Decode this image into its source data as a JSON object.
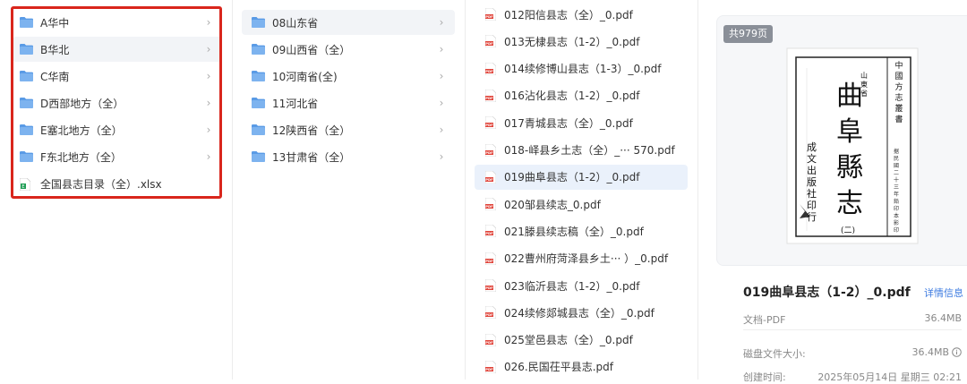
{
  "col1": {
    "items": [
      {
        "label": "A华中",
        "type": "folder",
        "chevron": true,
        "selected": false
      },
      {
        "label": "B华北",
        "type": "folder",
        "chevron": true,
        "selected": true
      },
      {
        "label": "C华南",
        "type": "folder",
        "chevron": true,
        "selected": false
      },
      {
        "label": "D西部地方（全）",
        "type": "folder",
        "chevron": true,
        "selected": false
      },
      {
        "label": "E塞北地方（全）",
        "type": "folder",
        "chevron": true,
        "selected": false
      },
      {
        "label": "F东北地方（全）",
        "type": "folder",
        "chevron": true,
        "selected": false
      },
      {
        "label": "全国县志目录（全）.xlsx",
        "type": "xlsx",
        "chevron": false,
        "selected": false
      }
    ]
  },
  "col2": {
    "items": [
      {
        "label": "08山东省",
        "selected": true
      },
      {
        "label": "09山西省（全）",
        "selected": false
      },
      {
        "label": "10河南省(全)",
        "selected": false
      },
      {
        "label": "11河北省",
        "selected": false
      },
      {
        "label": "12陕西省（全）",
        "selected": false
      },
      {
        "label": "13甘肃省（全）",
        "selected": false
      }
    ]
  },
  "col3": {
    "items": [
      {
        "label": "012阳信县志（全）_0.pdf",
        "active": false
      },
      {
        "label": "013无棣县志（1-2）_0.pdf",
        "active": false
      },
      {
        "label": "014续修博山县志（1-3）_0.pdf",
        "active": false
      },
      {
        "label": "016沾化县志（1-2）_0.pdf",
        "active": false
      },
      {
        "label": "017青城县志（全）_0.pdf",
        "active": false
      },
      {
        "label": "018-峄县乡土志（全）_··· 570.pdf",
        "active": false
      },
      {
        "label": "019曲阜县志（1-2）_0.pdf",
        "active": true
      },
      {
        "label": "020邹县续志_0.pdf",
        "active": false
      },
      {
        "label": "021滕县续志稿（全）_0.pdf",
        "active": false
      },
      {
        "label": "022曹州府菏泽县乡土···  ）_0.pdf",
        "active": false
      },
      {
        "label": "023临沂县志（1-2）_0.pdf",
        "active": false
      },
      {
        "label": "024续修郯城县志（全）_0.pdf",
        "active": false
      },
      {
        "label": "025堂邑县志（全）_0.pdf",
        "active": false
      },
      {
        "label": "026.民国茌平县志.pdf",
        "active": false
      }
    ],
    "pdf_badge": "PDF"
  },
  "preview": {
    "page_count": "共979页",
    "book": {
      "big_title": [
        "曲",
        "阜",
        "縣",
        "志"
      ],
      "vol": "(二)",
      "province": "山東省",
      "series": "中國方志叢書",
      "publisher": "成文出版社印行",
      "small_note": "据民國二十三年鉛印本影印"
    },
    "file_title": "019曲阜县志（1-2）_0.pdf",
    "detail_link": "详情信息",
    "type_label": "文档-PDF",
    "type_size": "36.4MB",
    "disk_label": "磁盘文件大小:",
    "disk_size": "36.4MB",
    "created_label": "创建时间:",
    "created_value": "2025年05月14日 星期三 02:21"
  },
  "colors": {
    "folder": "#5a9be6",
    "folder_tab": "#7db3ef",
    "highlight": "#d9261c",
    "pdf": "#e0443a",
    "link": "#3d7be0",
    "active_row": "#eaf1fb"
  }
}
